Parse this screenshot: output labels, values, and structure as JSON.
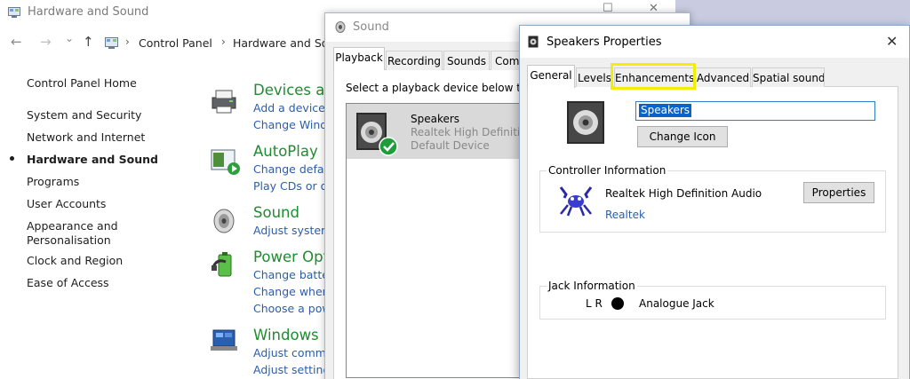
{
  "control_panel": {
    "title": "Hardware and Sound",
    "breadcrumbs": [
      "Control Panel",
      "Hardware and Sou"
    ],
    "nav": [
      {
        "label": "Control Panel Home"
      },
      {
        "label": "System and Security"
      },
      {
        "label": "Network and Internet"
      },
      {
        "label": "Hardware and Sound",
        "active": true
      },
      {
        "label": "Programs"
      },
      {
        "label": "User Accounts"
      },
      {
        "label": "Appearance and"
      },
      {
        "label": "Personalisation"
      },
      {
        "label": "Clock and Region"
      },
      {
        "label": "Ease of Access"
      }
    ],
    "categories": [
      {
        "title": "Devices an",
        "links": [
          "Add a device",
          "Change Windo"
        ],
        "icon": "devices-printer-icon"
      },
      {
        "title": "AutoPlay",
        "links": [
          "Change defau",
          "Play CDs or ot"
        ],
        "icon": "autoplay-icon"
      },
      {
        "title": "Sound",
        "links": [
          "Adjust system"
        ],
        "icon": "speaker-icon"
      },
      {
        "title": "Power Opti",
        "links": [
          "Change batter",
          "Change when",
          "Choose a pow"
        ],
        "icon": "power-battery-icon"
      },
      {
        "title": "Windows M",
        "links": [
          "Adjust commo",
          "Adjust setting"
        ],
        "icon": "windows-mobility-icon"
      }
    ]
  },
  "sound_dialog": {
    "title": "Sound",
    "tabs": [
      "Playback",
      "Recording",
      "Sounds",
      "Comm"
    ],
    "selected_tab": "Playback",
    "instruction": "Select a playback device below to m",
    "device": {
      "name": "Speakers",
      "driver": "Realtek High Definitio",
      "status": "Default Device"
    }
  },
  "speakers_properties": {
    "title": "Speakers Properties",
    "close_glyph": "✕",
    "tabs": [
      "General",
      "Levels",
      "Enhancements",
      "Advanced",
      "Spatial sound"
    ],
    "selected_tab": "General",
    "highlighted_tab": "Enhancements",
    "device_name": "Speakers",
    "change_icon_label": "Change Icon",
    "controller": {
      "group_label": "Controller Information",
      "name": "Realtek High Definition Audio",
      "vendor": "Realtek",
      "properties_label": "Properties"
    },
    "jack": {
      "group_label": "Jack Information",
      "channels": "L R",
      "label": "Analogue Jack"
    }
  },
  "colors": {
    "highlight": "#f0ef0a",
    "link": "#2b5ea8",
    "category_title": "#1f8c2f",
    "selection": "#0a64c8"
  },
  "glyphs": {
    "back": "←",
    "forward": "→",
    "dropdown": "⌄",
    "up": "↑",
    "separator": "›",
    "minimize": "—",
    "maximize": "☐",
    "close": "✕"
  }
}
